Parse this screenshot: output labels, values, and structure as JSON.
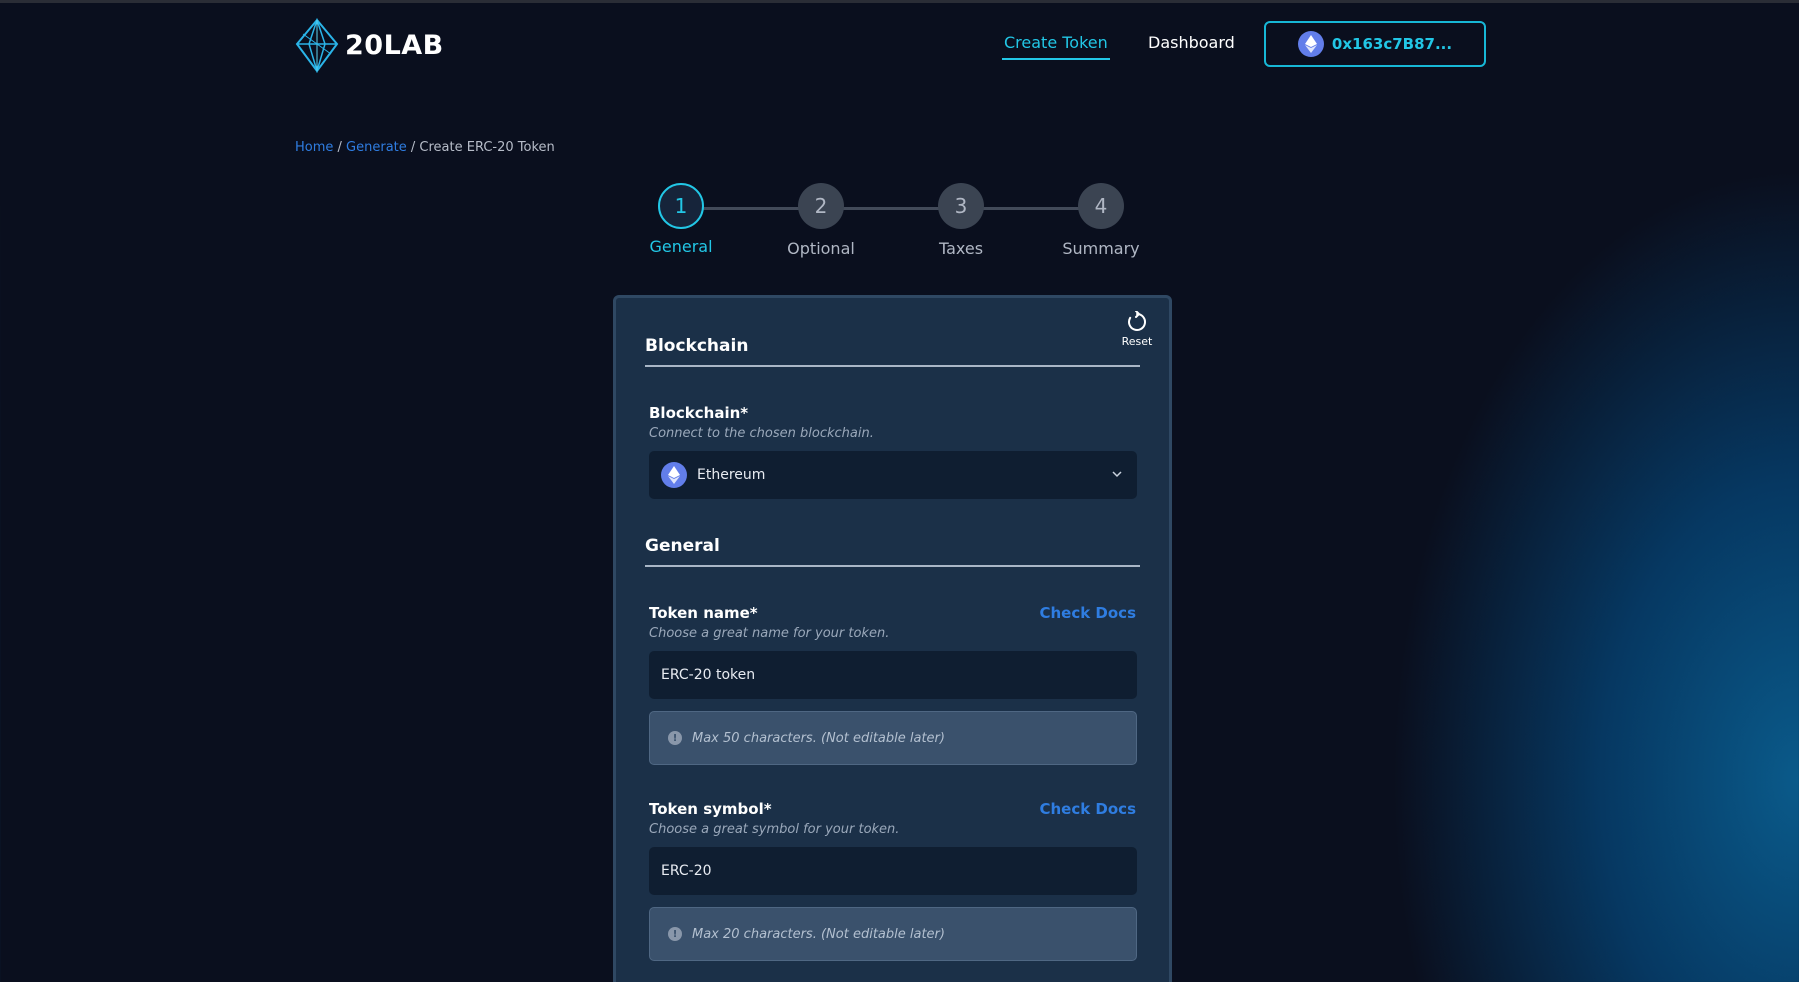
{
  "header": {
    "logo_text": "20LAB",
    "nav": {
      "create_token": "Create Token",
      "dashboard": "Dashboard"
    },
    "wallet_address": "0x163c7B87..."
  },
  "breadcrumb": {
    "home": "Home",
    "generate": "Generate",
    "current": "Create ERC-20 Token",
    "separator": " / "
  },
  "stepper": {
    "steps": [
      {
        "number": "1",
        "label": "General",
        "active": true
      },
      {
        "number": "2",
        "label": "Optional",
        "active": false
      },
      {
        "number": "3",
        "label": "Taxes",
        "active": false
      },
      {
        "number": "4",
        "label": "Summary",
        "active": false
      }
    ]
  },
  "card": {
    "reset_label": "Reset",
    "blockchain_section": {
      "title": "Blockchain",
      "label": "Blockchain*",
      "hint": "Connect to the chosen blockchain.",
      "selected": "Ethereum"
    },
    "general_section": {
      "title": "General",
      "token_name": {
        "label": "Token name*",
        "hint": "Choose a great name for your token.",
        "value": "ERC-20 token",
        "docs_link": "Check Docs",
        "note": "Max 50 characters. (Not editable later)"
      },
      "token_symbol": {
        "label": "Token symbol*",
        "hint": "Choose a great symbol for your token.",
        "value": "ERC-20",
        "docs_link": "Check Docs",
        "note": "Max 20 characters. (Not editable later)"
      }
    }
  },
  "colors": {
    "accent": "#22c7e6",
    "link": "#2f7de1",
    "card": "#1b3048",
    "background": "#0a0b19",
    "ethereum": "#627eea"
  }
}
